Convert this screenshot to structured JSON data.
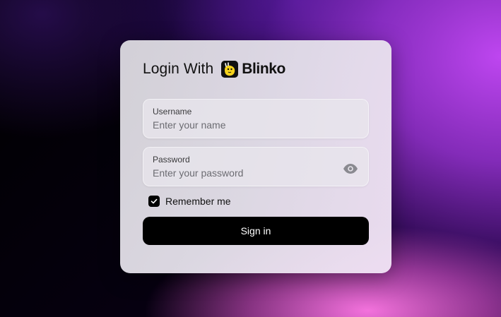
{
  "login": {
    "title": "Login With",
    "brand": "Blinko",
    "username": {
      "label": "Username",
      "placeholder": "Enter your name",
      "value": ""
    },
    "password": {
      "label": "Password",
      "placeholder": "Enter your password",
      "value": ""
    },
    "remember": {
      "label": "Remember me",
      "checked": true
    },
    "signin_label": "Sign in"
  },
  "colors": {
    "button": "#000000",
    "logo_accent": "#f5d21c"
  },
  "icons": {
    "logo": "blinko-logo-icon",
    "eye": "eye-icon",
    "check": "check-icon"
  }
}
